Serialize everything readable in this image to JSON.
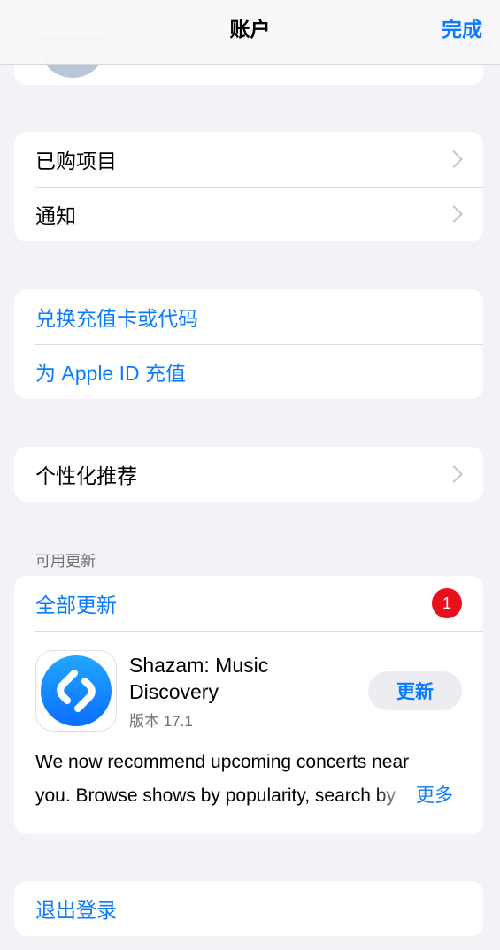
{
  "nav": {
    "title": "账户",
    "done_label": "完成"
  },
  "purchases_card": {
    "items": [
      {
        "label": "已购项目"
      },
      {
        "label": "通知"
      }
    ]
  },
  "balance_card": {
    "items": [
      {
        "label": "兑换充值卡或代码"
      },
      {
        "label": "为 Apple ID 充值"
      }
    ]
  },
  "personal_card": {
    "label": "个性化推荐"
  },
  "updates": {
    "section_label": "可用更新",
    "update_all_label": "全部更新",
    "badge_count": "1",
    "app": {
      "name": "Shazam: Music Discovery",
      "version": "版本 17.1",
      "update_label": "更新",
      "description_line1": "We now recommend upcoming concerts near",
      "description_line2": "you. Browse shows by popularity, search by",
      "more_label": "更多",
      "icon": "shazam-logo-icon",
      "icon_color": "#1a8cff"
    }
  },
  "signout": {
    "label": "退出登录"
  },
  "colors": {
    "accent": "#0a7aff",
    "badge": "#e8101c",
    "background": "#f2f2f7"
  }
}
